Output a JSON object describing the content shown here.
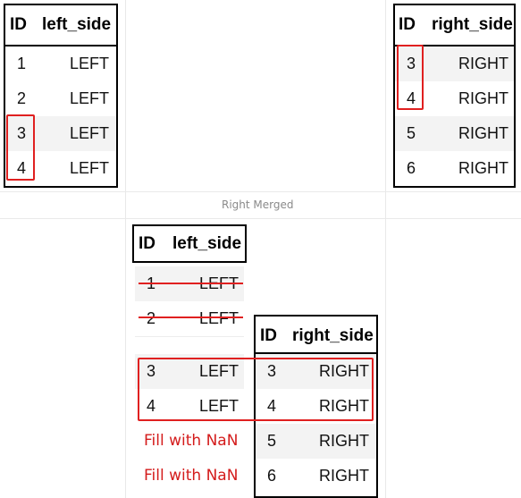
{
  "caption": "Right Merged",
  "left_table": {
    "headers": {
      "id": "ID",
      "value": "left_side"
    },
    "rows": [
      {
        "id": "1",
        "value": "LEFT"
      },
      {
        "id": "2",
        "value": "LEFT"
      },
      {
        "id": "3",
        "value": "LEFT"
      },
      {
        "id": "4",
        "value": "LEFT"
      }
    ]
  },
  "right_table": {
    "headers": {
      "id": "ID",
      "value": "right_side"
    },
    "rows": [
      {
        "id": "3",
        "value": "RIGHT"
      },
      {
        "id": "4",
        "value": "RIGHT"
      },
      {
        "id": "5",
        "value": "RIGHT"
      },
      {
        "id": "6",
        "value": "RIGHT"
      }
    ]
  },
  "merged": {
    "left_headers": {
      "id": "ID",
      "value": "left_side"
    },
    "dropped_rows": [
      {
        "id": "1",
        "value": "LEFT"
      },
      {
        "id": "2",
        "value": "LEFT"
      }
    ],
    "matched_left_rows": [
      {
        "id": "3",
        "value": "LEFT"
      },
      {
        "id": "4",
        "value": "LEFT"
      }
    ],
    "fill_labels": [
      "Fill with NaN",
      "Fill with NaN"
    ],
    "right_headers": {
      "id": "ID",
      "value": "right_side"
    },
    "right_rows": [
      {
        "id": "3",
        "value": "RIGHT"
      },
      {
        "id": "4",
        "value": "RIGHT"
      },
      {
        "id": "5",
        "value": "RIGHT"
      },
      {
        "id": "6",
        "value": "RIGHT"
      }
    ]
  },
  "colors": {
    "highlight": "#e02020",
    "fill_text": "#d41c1c",
    "stripe": "#f3f3f3"
  }
}
